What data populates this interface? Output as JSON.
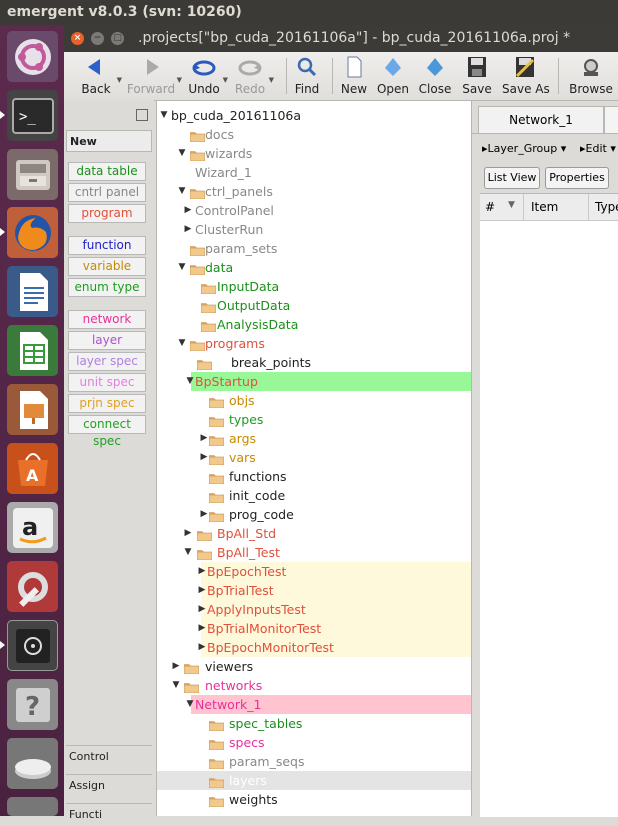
{
  "system": {
    "title": "emergent v8.0.3 (svn: 10260)"
  },
  "window": {
    "title": ".projects[\"bp_cuda_20161106a\"] - bp_cuda_20161106a.proj *"
  },
  "toolbar": {
    "back": "Back",
    "forward": "Forward",
    "undo": "Undo",
    "redo": "Redo",
    "find": "Find",
    "new": "New",
    "open": "Open",
    "close": "Close",
    "save": "Save",
    "save_as": "Save As",
    "browse": "Browse"
  },
  "toolbox": {
    "tabs": {
      "new": "New",
      "control": "Control",
      "assign": "Assign",
      "functi": "Functi"
    },
    "tools": [
      {
        "label": "data table",
        "color": "#1a8f1a"
      },
      {
        "label": "cntrl panel",
        "color": "#888888"
      },
      {
        "label": "program",
        "color": "#e0503a"
      },
      {
        "label": "function",
        "color": "#2020c8"
      },
      {
        "label": "variable",
        "color": "#c68a00"
      },
      {
        "label": "enum type",
        "color": "#1a9f1a"
      },
      {
        "label": "network",
        "color": "#e8309a"
      },
      {
        "label": "layer",
        "color": "#b050d0"
      },
      {
        "label": "layer spec",
        "color": "#b080e0"
      },
      {
        "label": "unit spec",
        "color": "#e080e0"
      },
      {
        "label": "prjn spec",
        "color": "#e0a020"
      },
      {
        "label": "connect spec",
        "color": "#20a020"
      }
    ]
  },
  "colors": {
    "highlight_green": "#98f898",
    "highlight_yellow": "#fff9dc",
    "highlight_pink": "#ffc4d0",
    "selected_gray": "#e4e4e4"
  },
  "tree": {
    "items": [
      {
        "label": "bp_cuda_20161106a",
        "color": "#222222",
        "tw": "down",
        "folder": false
      },
      {
        "label": "docs",
        "color": "#888888",
        "tw": "",
        "folder": true
      },
      {
        "label": "wizards",
        "color": "#888888",
        "tw": "down",
        "folder": true
      },
      {
        "label": "Wizard_1",
        "color": "#888888",
        "tw": "",
        "folder": false
      },
      {
        "label": "ctrl_panels",
        "color": "#888888",
        "tw": "down",
        "folder": true
      },
      {
        "label": "ControlPanel",
        "color": "#888888",
        "tw": "right",
        "folder": false
      },
      {
        "label": "ClusterRun",
        "color": "#888888",
        "tw": "right",
        "folder": false
      },
      {
        "label": "param_sets",
        "color": "#888888",
        "tw": "",
        "folder": true
      },
      {
        "label": "data",
        "color": "#1a8f1a",
        "tw": "down",
        "folder": true
      },
      {
        "label": "InputData",
        "color": "#1a8f1a",
        "tw": "",
        "folder": true
      },
      {
        "label": "OutputData",
        "color": "#1a8f1a",
        "tw": "",
        "folder": true
      },
      {
        "label": "AnalysisData",
        "color": "#1a8f1a",
        "tw": "",
        "folder": true
      },
      {
        "label": "programs",
        "color": "#e0503a",
        "tw": "down",
        "folder": true
      },
      {
        "label": "break_points",
        "color": "#222222",
        "tw": "",
        "folder": true
      },
      {
        "label": "BpStartup",
        "color": "#e0503a",
        "tw": "down",
        "folder": false
      },
      {
        "label": "objs",
        "color": "#c68a00",
        "tw": "",
        "folder": true
      },
      {
        "label": "types",
        "color": "#1a9f1a",
        "tw": "",
        "folder": true
      },
      {
        "label": "args",
        "color": "#c68a00",
        "tw": "right",
        "folder": true
      },
      {
        "label": "vars",
        "color": "#c68a00",
        "tw": "right",
        "folder": true
      },
      {
        "label": "functions",
        "color": "#222222",
        "tw": "",
        "folder": true
      },
      {
        "label": "init_code",
        "color": "#222222",
        "tw": "",
        "folder": true
      },
      {
        "label": "prog_code",
        "color": "#222222",
        "tw": "right",
        "folder": true
      },
      {
        "label": "BpAll_Std",
        "color": "#e0503a",
        "tw": "right",
        "folder": true
      },
      {
        "label": "BpAll_Test",
        "color": "#e0503a",
        "tw": "down",
        "folder": true
      },
      {
        "label": "BpEpochTest",
        "color": "#e0503a",
        "tw": "right",
        "folder": false
      },
      {
        "label": "BpTrialTest",
        "color": "#e0503a",
        "tw": "right",
        "folder": false
      },
      {
        "label": "ApplyInputsTest",
        "color": "#e0503a",
        "tw": "right",
        "folder": false
      },
      {
        "label": "BpTrialMonitorTest",
        "color": "#e0503a",
        "tw": "right",
        "folder": false
      },
      {
        "label": "BpEpochMonitorTest",
        "color": "#e0503a",
        "tw": "right",
        "folder": false
      },
      {
        "label": "viewers",
        "color": "#222222",
        "tw": "right",
        "folder": true
      },
      {
        "label": "networks",
        "color": "#e8309a",
        "tw": "down",
        "folder": true
      },
      {
        "label": "Network_1",
        "color": "#e8309a",
        "tw": "down",
        "folder": false
      },
      {
        "label": "spec_tables",
        "color": "#1a8f1a",
        "tw": "",
        "folder": true
      },
      {
        "label": "specs",
        "color": "#e8309a",
        "tw": "",
        "folder": true
      },
      {
        "label": "param_seqs",
        "color": "#888888",
        "tw": "",
        "folder": true
      },
      {
        "label": "layers",
        "color": "#ffffff",
        "tw": "",
        "folder": true
      },
      {
        "label": "weights",
        "color": "#222222",
        "tw": "",
        "folder": true
      }
    ]
  },
  "right": {
    "tab": "Network_1",
    "menu1": "Layer_Group",
    "menu2": "Edit",
    "list_view": "List View",
    "properties": "Properties",
    "col_num": "#",
    "col_item": "Item",
    "col_type": "Type"
  }
}
